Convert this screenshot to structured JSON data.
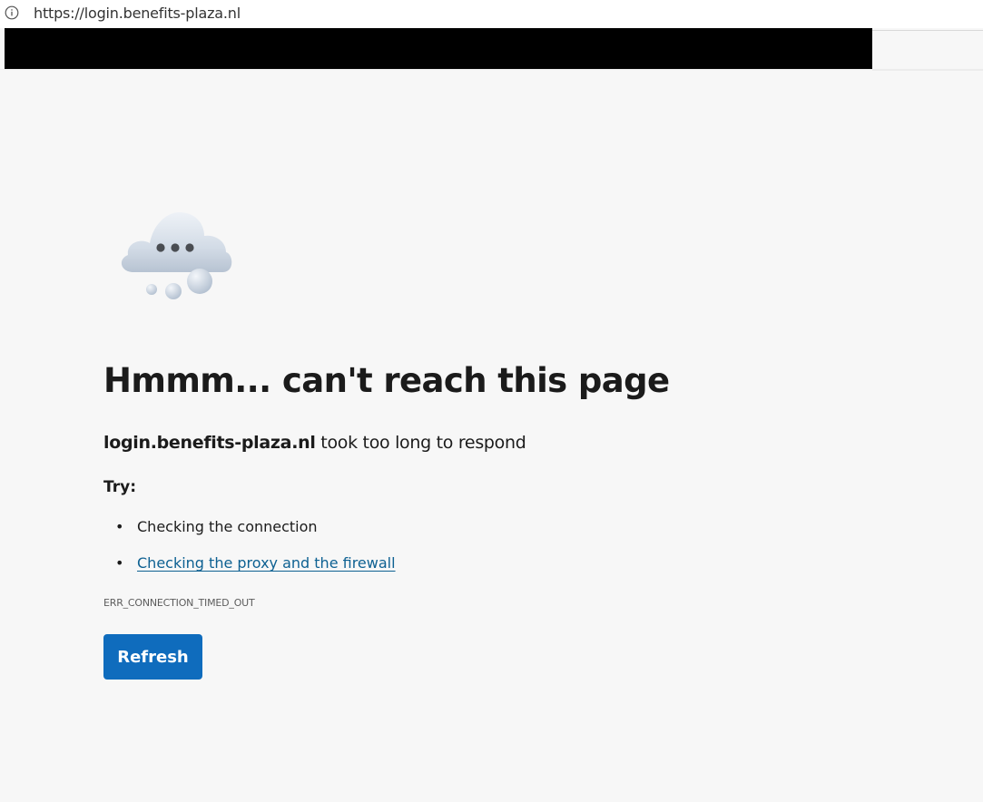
{
  "browser": {
    "url": "https://login.benefits-plaza.nl",
    "info_icon": "info-icon"
  },
  "error_page": {
    "illustration_icon": "cloud-thinking-icon",
    "heading": "Hmmm... can't reach this page",
    "host": "login.benefits-plaza.nl",
    "message": " took too long to respond",
    "try_label": "Try:",
    "suggestions": [
      {
        "bullet": "•",
        "label": "Checking the connection",
        "is_link": false
      },
      {
        "bullet": "•",
        "label": "Checking the proxy and the firewall",
        "is_link": true
      }
    ],
    "error_code": "ERR_CONNECTION_TIMED_OUT",
    "refresh_label": "Refresh"
  },
  "colors": {
    "page_background": "#f7f7f7",
    "primary_button": "#0f6cbd",
    "link": "#0e6192",
    "redaction": "#000000"
  }
}
